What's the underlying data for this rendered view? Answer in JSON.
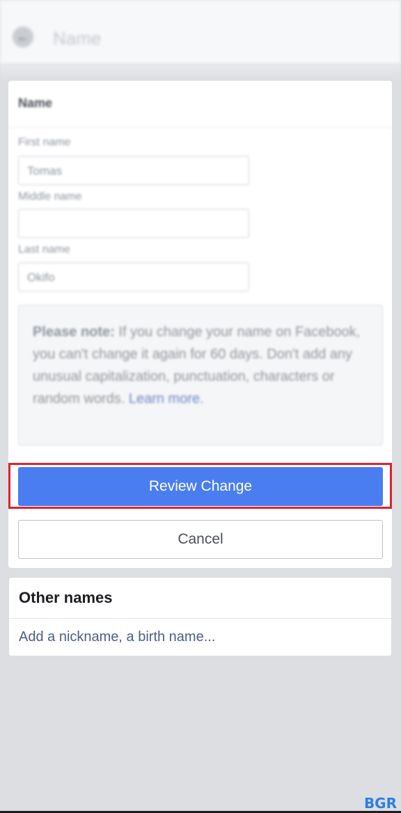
{
  "header": {
    "back_icon": "arrow-left-icon",
    "title": "Name"
  },
  "name_form": {
    "section_title": "Name",
    "first_name_label": "First name",
    "first_name_value": "Tomas",
    "middle_name_label": "Middle name",
    "middle_name_value": "",
    "last_name_label": "Last name",
    "last_name_value": "Okifo",
    "note_lead": "Please note:",
    "note_body": " If you change your name on Facebook, you can't change it again for 60 days. Don't add any unusual capitalization, punctuation, characters or random words. ",
    "note_link": "Learn more",
    "note_end": "."
  },
  "actions": {
    "review_label": "Review Change",
    "cancel_label": "Cancel",
    "highlight_color": "#e02130",
    "primary_color": "#4a7ef0"
  },
  "other_names": {
    "title": "Other names",
    "add_link": "Add a nickname, a birth name..."
  },
  "watermark": "BGR"
}
